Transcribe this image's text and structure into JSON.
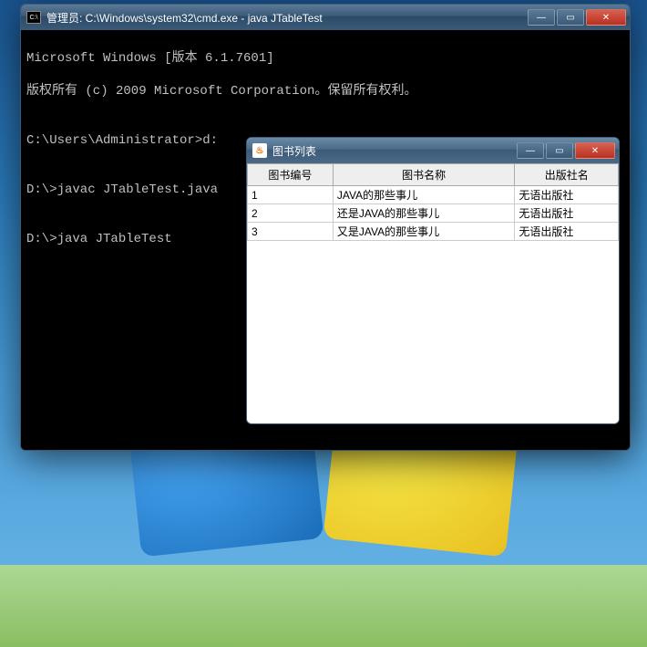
{
  "cmd": {
    "title": "管理员: C:\\Windows\\system32\\cmd.exe - java  JTableTest",
    "lines": {
      "l1": "Microsoft Windows [版本 6.1.7601]",
      "l2": "版权所有 (c) 2009 Microsoft Corporation。保留所有权利。",
      "l3": "",
      "l4": "C:\\Users\\Administrator>d:",
      "l5": "",
      "l6": "D:\\>javac JTableTest.java",
      "l7": "",
      "l8": "D:\\>java JTableTest"
    }
  },
  "swing": {
    "title": "图书列表",
    "headers": [
      "图书编号",
      "图书名称",
      "出版社名"
    ],
    "rows": [
      {
        "id": "1",
        "name": "JAVA的那些事儿",
        "pub": "无语出版社"
      },
      {
        "id": "2",
        "name": "还是JAVA的那些事儿",
        "pub": "无语出版社"
      },
      {
        "id": "3",
        "name": "又是JAVA的那些事儿",
        "pub": "无语出版社"
      }
    ]
  },
  "icons": {
    "cmd": "C:\\",
    "java": "♨"
  },
  "buttons": {
    "min": "—",
    "max": "▭",
    "close": "✕"
  }
}
